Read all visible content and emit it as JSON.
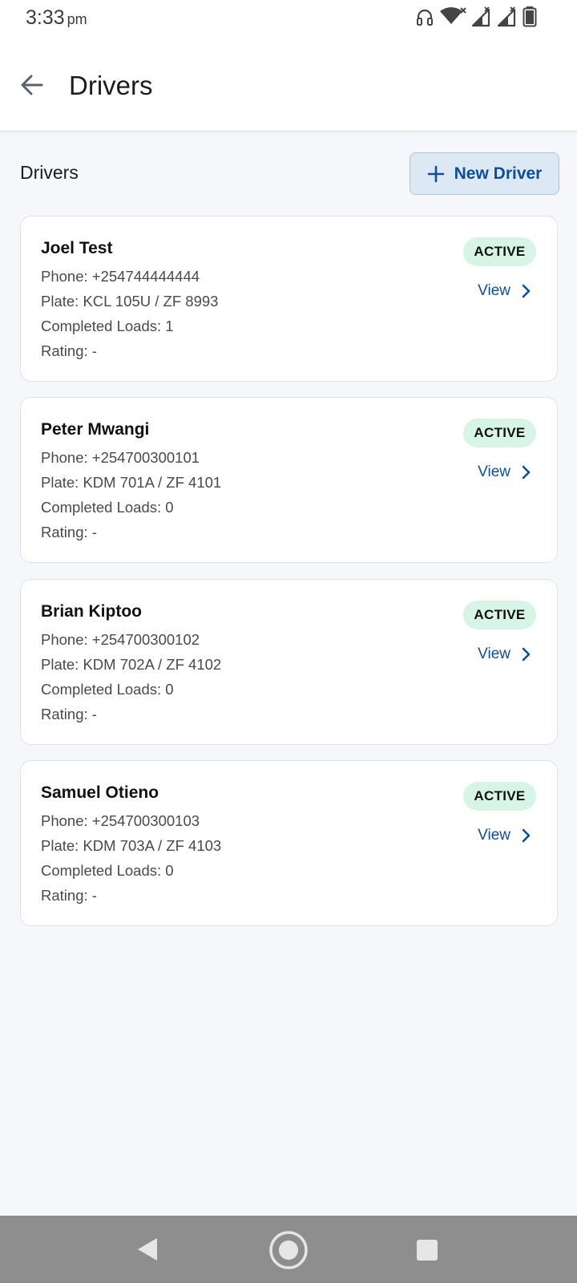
{
  "status_bar": {
    "time": "3:33",
    "ampm": "pm",
    "icons": [
      "headphones-icon",
      "wifi-icon",
      "signal-icon",
      "signal-icon",
      "battery-icon"
    ]
  },
  "app_bar": {
    "title": "Drivers",
    "back_icon": "arrow-left-icon"
  },
  "section": {
    "title": "Drivers",
    "new_button_label": "New Driver",
    "new_button_icon": "plus-icon"
  },
  "drivers": [
    {
      "name": "Joel Test",
      "phone": "Phone: +254744444444",
      "plate": "Plate: KCL 105U / ZF 8993",
      "completed": "Completed Loads: 1",
      "rating": "Rating: -",
      "status": "ACTIVE",
      "view_label": "View"
    },
    {
      "name": "Peter Mwangi",
      "phone": "Phone: +254700300101",
      "plate": "Plate: KDM 701A / ZF 4101",
      "completed": "Completed Loads: 0",
      "rating": "Rating: -",
      "status": "ACTIVE",
      "view_label": "View"
    },
    {
      "name": "Brian Kiptoo",
      "phone": "Phone: +254700300102",
      "plate": "Plate: KDM 702A / ZF 4102",
      "completed": "Completed Loads: 0",
      "rating": "Rating: -",
      "status": "ACTIVE",
      "view_label": "View"
    },
    {
      "name": "Samuel Otieno",
      "phone": "Phone: +254700300103",
      "plate": "Plate: KDM 703A / ZF 4103",
      "completed": "Completed Loads: 0",
      "rating": "Rating: -",
      "status": "ACTIVE",
      "view_label": "View"
    }
  ],
  "nav_bar": {
    "buttons": [
      "back-triangle-icon",
      "home-circle-icon",
      "recents-square-icon"
    ]
  },
  "colors": {
    "accent": "#0f4e97",
    "badge_bg": "#d6f5e6",
    "page_bg": "#f5f7fa"
  }
}
